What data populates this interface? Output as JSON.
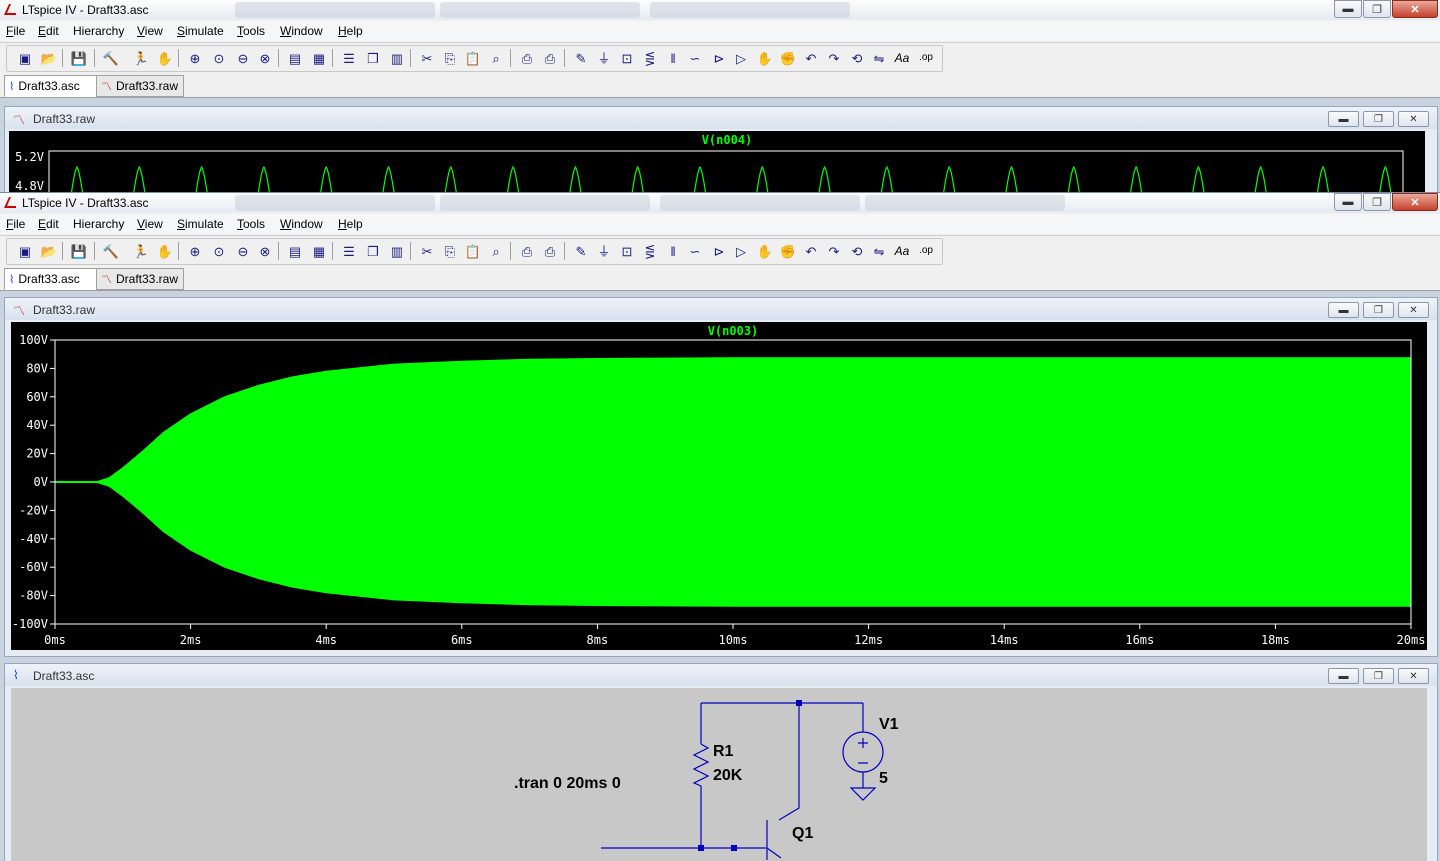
{
  "window": {
    "title": "LTspice IV - Draft33.asc",
    "minimize": "▬",
    "restore": "❐",
    "close": "✕"
  },
  "menu": {
    "items": [
      {
        "label": "File",
        "key": "F",
        "rest": "ile"
      },
      {
        "label": "Edit",
        "key": "E",
        "rest": "dit"
      },
      {
        "label": "Hierarchy",
        "key": "H",
        "rest": "ierarchy",
        "underline_index": 1
      },
      {
        "label": "View",
        "key": "V",
        "rest": "iew"
      },
      {
        "label": "Simulate",
        "key": "S",
        "rest": "imulate"
      },
      {
        "label": "Tools",
        "key": "T",
        "rest": "ools"
      },
      {
        "label": "Window",
        "key": "W",
        "rest": "indow"
      },
      {
        "label": "Help",
        "key": "H",
        "rest": "elp"
      }
    ]
  },
  "toolbar": {
    "icons": [
      "new-schematic-icon",
      "open-icon",
      "save-icon",
      "control-panel-icon",
      "run-icon",
      "pan-hand-icon",
      "zoom-in-icon",
      "zoom-full-icon",
      "zoom-out-icon",
      "zoom-cancel-icon",
      "autorange-icon",
      "grid-icon",
      "tile-horizontal-icon",
      "cascade-icon",
      "tile-vertical-icon",
      "cut-icon",
      "copy-icon",
      "paste-icon",
      "find-icon",
      "print-setup-icon",
      "print-icon",
      "wire-icon",
      "ground-icon",
      "label-icon",
      "resistor-icon",
      "capacitor-icon",
      "inductor-icon",
      "diode-icon",
      "component-icon",
      "move-icon",
      "drag-icon",
      "undo-icon",
      "redo-icon",
      "rotate-icon",
      "mirror-icon",
      "text-icon",
      "spice-directive-icon"
    ],
    "text_aa": "Aa",
    "text_op": ".op"
  },
  "tabs": [
    {
      "label": "Draft33.asc",
      "icon": "schematic-icon",
      "active": true
    },
    {
      "label": "Draft33.raw",
      "icon": "waveform-icon",
      "active": false
    }
  ],
  "back_plot": {
    "window_title": "Draft33.raw",
    "trace": "V(n004)",
    "yticks": [
      "5.2V",
      "4.8V"
    ],
    "color": "#00ff00"
  },
  "front_plot": {
    "window_title": "Draft33.raw",
    "trace": "V(n003)",
    "color": "#00ff00"
  },
  "chart_data": {
    "type": "area",
    "title": "V(n003)",
    "xlabel": "",
    "ylabel": "",
    "x_ticks": [
      "0ms",
      "2ms",
      "4ms",
      "6ms",
      "8ms",
      "10ms",
      "12ms",
      "14ms",
      "16ms",
      "18ms",
      "20ms"
    ],
    "y_ticks": [
      "100V",
      "80V",
      "60V",
      "40V",
      "20V",
      "0V",
      "-20V",
      "-40V",
      "-60V",
      "-80V",
      "-100V"
    ],
    "xlim": [
      0,
      20
    ],
    "ylim": [
      -100,
      100
    ],
    "series": [
      {
        "color": "#00ff00",
        "x": [
          0,
          0.6,
          0.8,
          1.0,
          1.3,
          1.6,
          2.0,
          2.5,
          3.0,
          3.5,
          4.0,
          5.0,
          6.0,
          7.0,
          8.0,
          10.0,
          12.0,
          14.0,
          16.0,
          18.0,
          20.0
        ],
        "upper": [
          0,
          0,
          3,
          10,
          22,
          35,
          48,
          60,
          68,
          74,
          78,
          83,
          85,
          86.5,
          87,
          87.5,
          87.5,
          87.5,
          87.5,
          87.5,
          87.5
        ],
        "lower": [
          0,
          0,
          -3,
          -10,
          -22,
          -35,
          -48,
          -60,
          -68,
          -74,
          -78,
          -83,
          -85,
          -86.5,
          -87,
          -87.5,
          -87.5,
          -87.5,
          -87.5,
          -87.5,
          -87.5
        ]
      }
    ],
    "grid": false
  },
  "schematic": {
    "window_title": "Draft33.asc",
    "directive": ".tran 0 20ms 0",
    "r1_name": "R1",
    "r1_value": "20K",
    "v1_name": "V1",
    "v1_value": "5",
    "q1_name": "Q1",
    "wire_color": "#0000c0"
  }
}
